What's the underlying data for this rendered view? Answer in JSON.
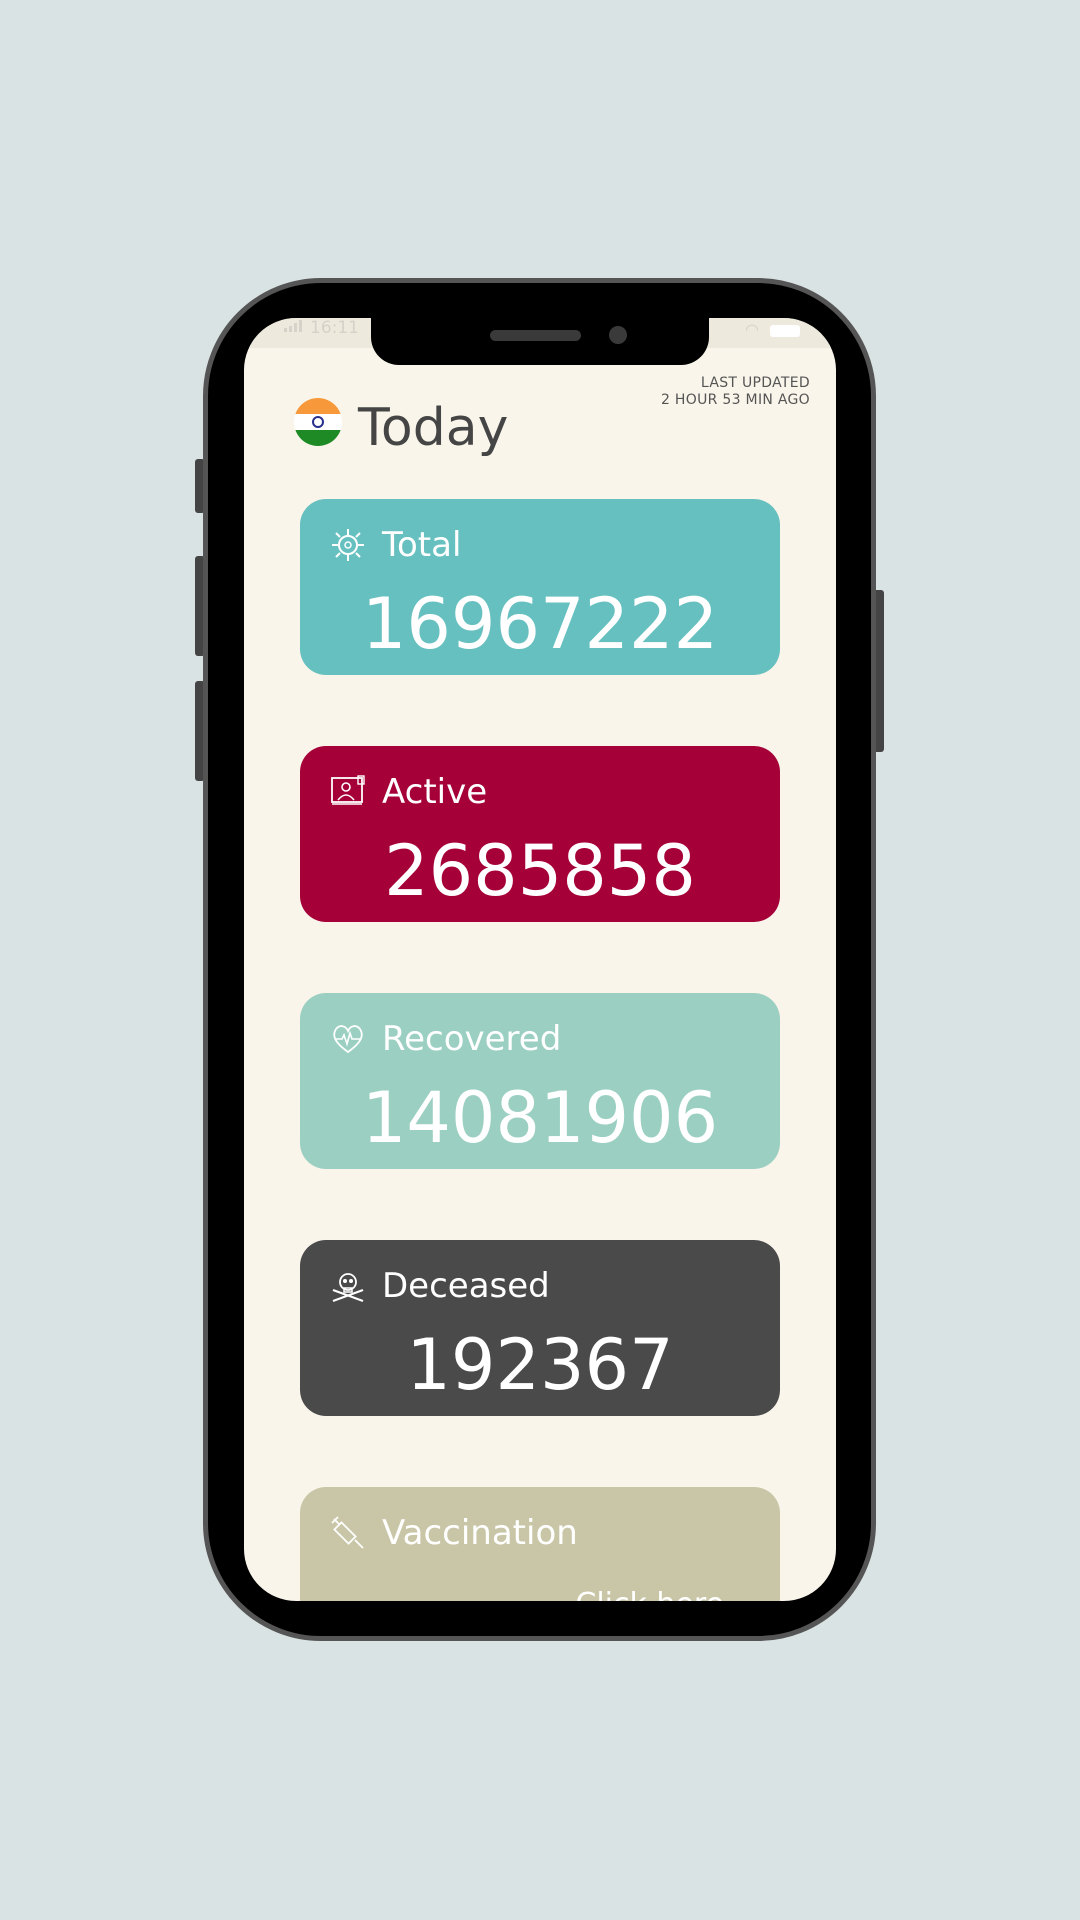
{
  "status": {
    "time": "16:11"
  },
  "header": {
    "title": "Today",
    "last_updated_label": "LAST UPDATED",
    "last_updated_value": "2 HOUR 53 MIN AGO"
  },
  "cards": [
    {
      "label": "Total",
      "value": "16967222",
      "icon": "virus-icon",
      "color": "#67c0c0"
    },
    {
      "label": "Active",
      "value": "2685858",
      "icon": "patient-bed-icon",
      "color": "#a60038"
    },
    {
      "label": "Recovered",
      "value": "14081906",
      "icon": "heartbeat-icon",
      "color": "#9bcfc2"
    },
    {
      "label": "Deceased",
      "value": "192367",
      "icon": "skull-crossbones-icon",
      "color": "#4a4a4a"
    },
    {
      "label": "Vaccination",
      "link": "Click here",
      "icon": "syringe-icon",
      "color": "#c8c6a6"
    }
  ]
}
